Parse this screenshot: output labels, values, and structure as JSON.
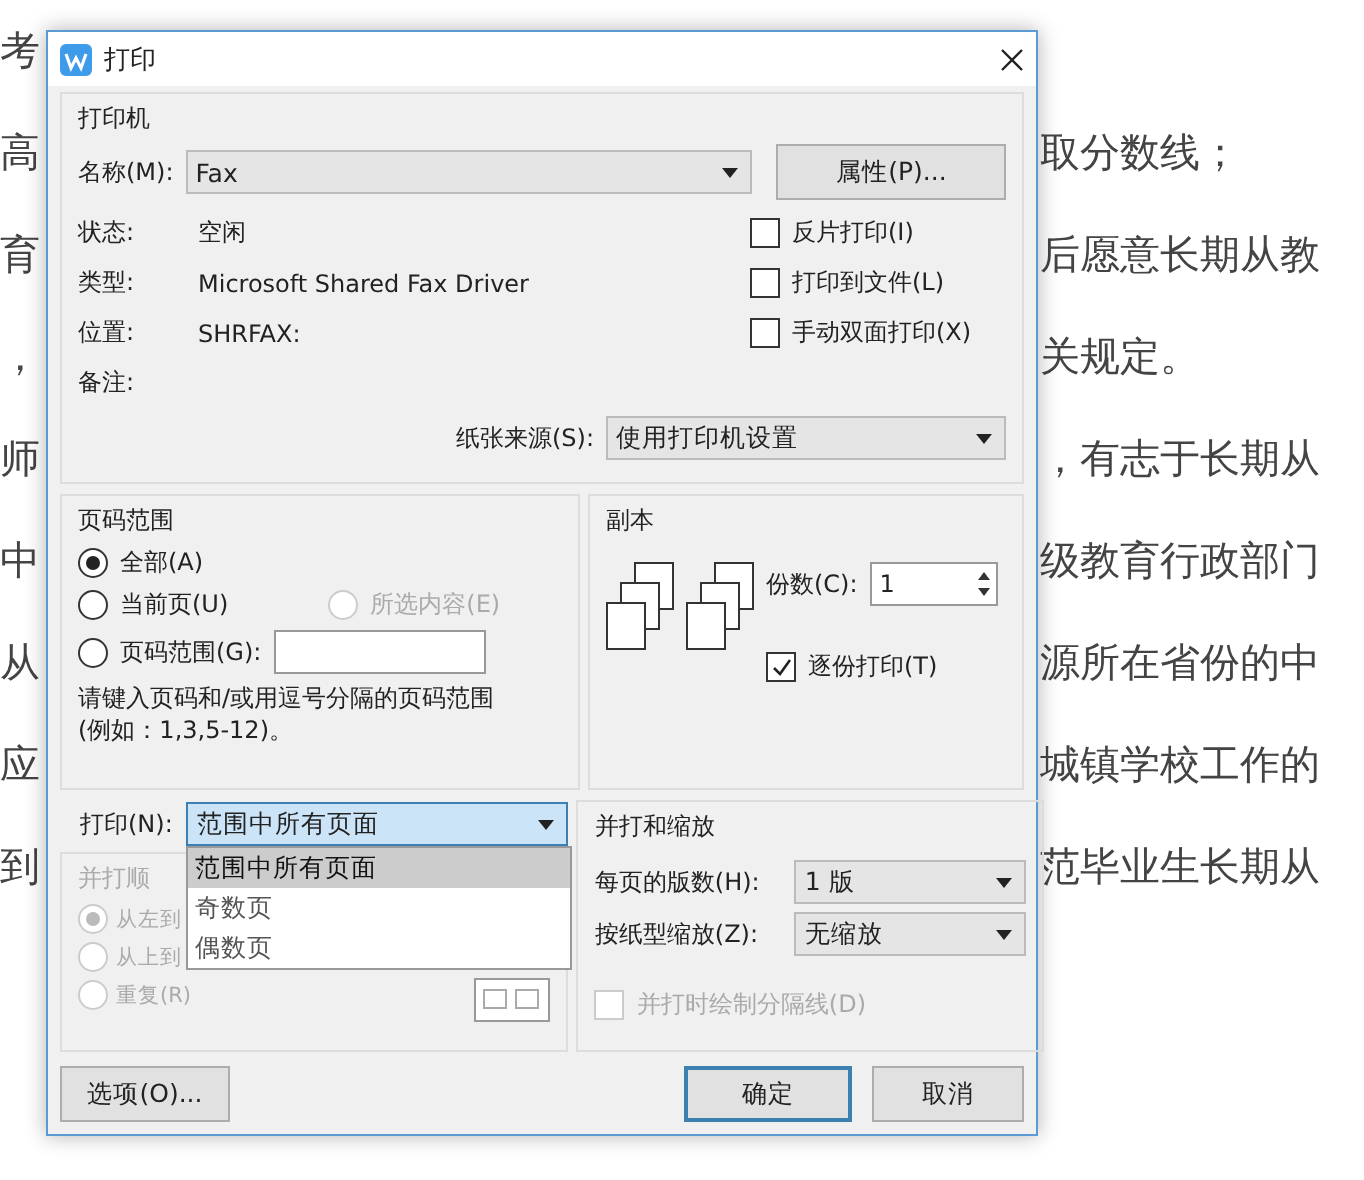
{
  "document": {
    "lines": [
      {
        "left": "考"
      },
      {
        "left": "高",
        "right": "取分数线；"
      },
      {
        "left": "育",
        "right": "后愿意长期从教"
      },
      {
        "left": "，",
        "right": "关规定。"
      },
      {
        "left": "师",
        "right": "，有志于长期从"
      },
      {
        "left": "中",
        "right": "级教育行政部门"
      },
      {
        "left": "从",
        "right": "源所在省份的中"
      },
      {
        "left": "应",
        "right": "城镇学校工作的"
      },
      {
        "left": "到",
        "right": "范毕业生长期从"
      }
    ]
  },
  "window": {
    "title": "打印"
  },
  "printer": {
    "title": "打印机",
    "name_label": "名称(M):",
    "name_value": "Fax",
    "properties_button": "属性(P)...",
    "info": [
      {
        "label": "状态:",
        "value": "空闲"
      },
      {
        "label": "类型:",
        "value": "Microsoft Shared Fax Driver"
      },
      {
        "label": "位置:",
        "value": "SHRFAX:"
      },
      {
        "label": "备注:"
      }
    ],
    "options": [
      {
        "label": "反片打印(I)",
        "checked": false
      },
      {
        "label": "打印到文件(L)",
        "checked": false
      },
      {
        "label": "手动双面打印(X)",
        "checked": false
      }
    ],
    "paper_source_label": "纸张来源(S):",
    "paper_source_value": "使用打印机设置"
  },
  "page_range": {
    "title": "页码范围",
    "radios": [
      {
        "label": "全部(A)",
        "selected": true,
        "disabled": false
      },
      {
        "label": "当前页(U)",
        "selected": false,
        "disabled": false
      },
      {
        "label": "所选内容(E)",
        "selected": false,
        "disabled": true
      },
      {
        "label": "页码范围(G):",
        "selected": false,
        "disabled": false
      }
    ],
    "hint": "请键入页码和/或用逗号分隔的页码范围\n(例如：1,3,5-12)。"
  },
  "print_select": {
    "label": "打印(N):",
    "value": "范围中所有页面",
    "expanded": true,
    "options": [
      {
        "label": "范围中所有页面",
        "selected": true
      },
      {
        "label": "奇数页",
        "selected": false
      },
      {
        "label": "偶数页",
        "selected": false
      }
    ]
  },
  "collation": {
    "title": "并打顺",
    "disabled": true,
    "radios": [
      {
        "label": "从左到",
        "selected": true
      },
      {
        "label": "从上到",
        "selected": false
      },
      {
        "label": "重复(R)",
        "selected": false
      }
    ]
  },
  "copies": {
    "title": "副本",
    "count_label": "份数(C):",
    "count_value": "1",
    "collate": {
      "label": "逐份打印(T)",
      "checked": true
    }
  },
  "zoom": {
    "title": "并打和缩放",
    "rows": [
      {
        "label": "每页的版数(H):",
        "value": "1 版"
      },
      {
        "label": "按纸型缩放(Z):",
        "value": "无缩放"
      }
    ],
    "separator": {
      "label": "并打时绘制分隔线(D)",
      "checked": false,
      "disabled": true
    }
  },
  "buttons": {
    "options": "选项(O)...",
    "ok": "确定",
    "cancel": "取消"
  }
}
